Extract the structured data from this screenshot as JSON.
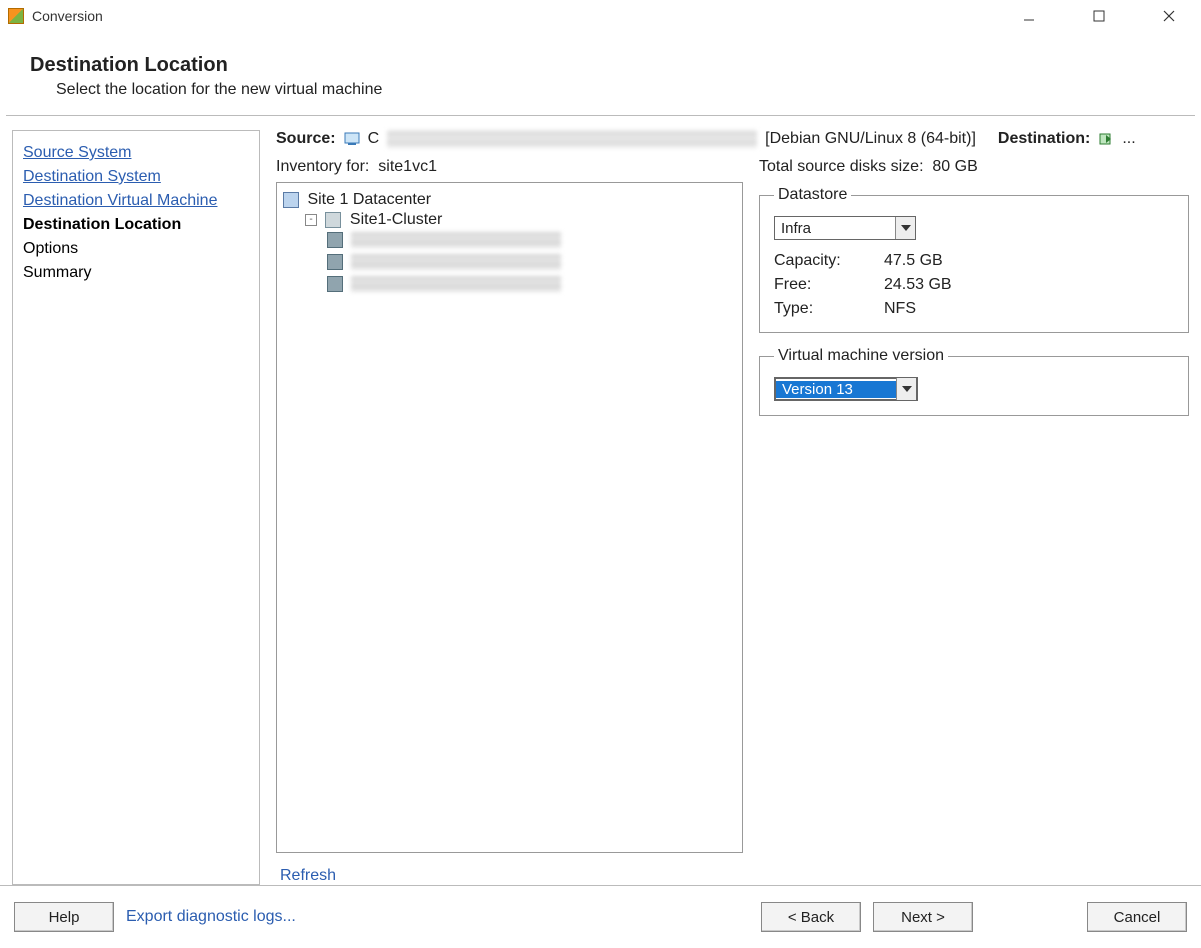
{
  "window": {
    "title": "Conversion"
  },
  "header": {
    "title": "Destination Location",
    "subtitle": "Select the location for the new virtual machine"
  },
  "steps": [
    {
      "label": "Source System",
      "state": "link"
    },
    {
      "label": "Destination System",
      "state": "link"
    },
    {
      "label": "Destination Virtual Machine",
      "state": "link"
    },
    {
      "label": "Destination Location",
      "state": "bold"
    },
    {
      "label": "Options",
      "state": "plain"
    },
    {
      "label": "Summary",
      "state": "plain"
    }
  ],
  "sourceLine": {
    "sourceLabel": "Source:",
    "sourceInitial": "C",
    "osText": "[Debian GNU/Linux 8 (64-bit)]",
    "destinationLabel": "Destination:",
    "destEllipsis": "..."
  },
  "inventory": {
    "labelPrefix": "Inventory for:",
    "labelValue": "site1vc1",
    "refresh": "Refresh",
    "tree": {
      "datacenter": "Site 1 Datacenter",
      "cluster": "Site1-Cluster",
      "hostCount": 3
    }
  },
  "totals": {
    "label": "Total source disks size:",
    "value": "80 GB"
  },
  "datastore": {
    "legend": "Datastore",
    "selected": "Infra",
    "capacityLabel": "Capacity:",
    "capacityValue": "47.5 GB",
    "freeLabel": "Free:",
    "freeValue": "24.53 GB",
    "typeLabel": "Type:",
    "typeValue": "NFS"
  },
  "vmversion": {
    "legend": "Virtual machine version",
    "selected": "Version 13"
  },
  "footer": {
    "help": "Help",
    "export": "Export diagnostic logs...",
    "back": "< Back",
    "next": "Next >",
    "cancel": "Cancel"
  }
}
